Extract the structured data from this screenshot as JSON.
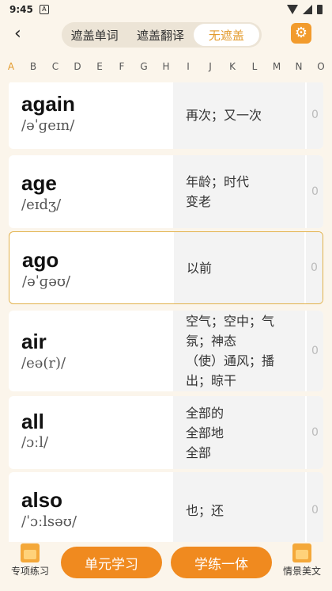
{
  "status_bar": {
    "time": "9:45",
    "badge": "A"
  },
  "header": {
    "back_label": "‹",
    "segments": [
      "遮盖单词",
      "遮盖翻译",
      "无遮盖"
    ],
    "active_segment": 2,
    "settings_icon": "gear-icon"
  },
  "alphabet": [
    "A",
    "B",
    "C",
    "D",
    "E",
    "F",
    "G",
    "H",
    "I",
    "J",
    "K",
    "L",
    "M",
    "N",
    "O"
  ],
  "active_letter": "A",
  "words": [
    {
      "word": "again",
      "phonetic": "/əˈɡeɪn/",
      "translation": [
        "再次；又一次"
      ],
      "count": "0"
    },
    {
      "word": "age",
      "phonetic": "/eɪdʒ/",
      "translation": [
        "年龄；时代",
        "变老"
      ],
      "count": "0"
    },
    {
      "word": "ago",
      "phonetic": "/əˈɡəʊ/",
      "translation": [
        "以前"
      ],
      "count": "0"
    },
    {
      "word": "air",
      "phonetic": "/eə(r)/",
      "translation": [
        "空气；空中；气",
        "氛；神态",
        "（使）通风；播",
        "出；晾干"
      ],
      "count": "0"
    },
    {
      "word": "all",
      "phonetic": "/ɔːl/",
      "translation": [
        "全部的",
        "全部地",
        "全部"
      ],
      "count": "0"
    },
    {
      "word": "also",
      "phonetic": "/ˈɔːlsəʊ/",
      "translation": [
        "也；还"
      ],
      "count": "0"
    }
  ],
  "bottom": {
    "left_tab": "专项练习",
    "button1": "单元学习",
    "button2": "学练一体",
    "right_tab": "情景美文"
  }
}
